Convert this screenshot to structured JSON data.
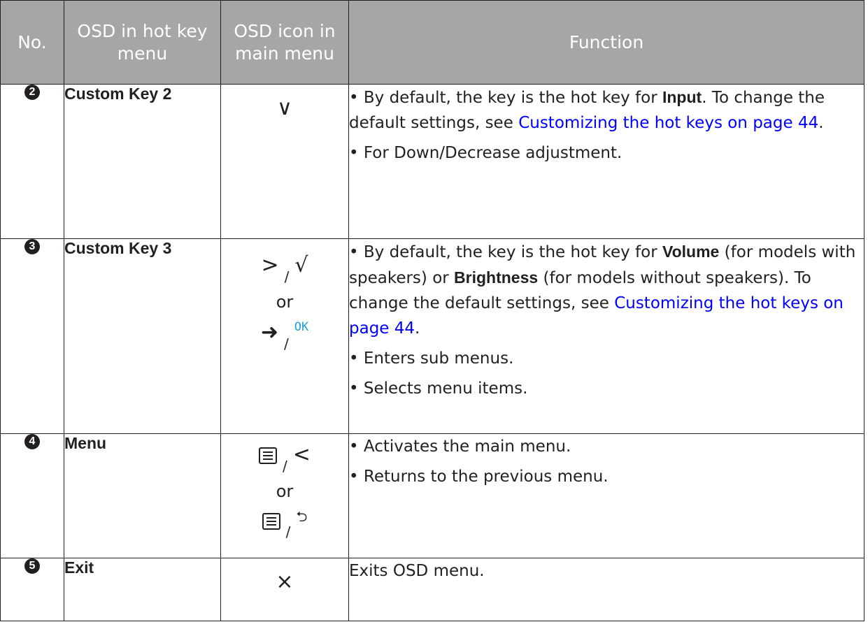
{
  "header": {
    "no": "No.",
    "osd_hot_key": "OSD in hot key menu",
    "osd_icon_main": "OSD icon in main menu",
    "function": "Function"
  },
  "rows": [
    {
      "number": "2",
      "name": "Custom Key 2",
      "icon": {
        "down": "∨"
      },
      "func": {
        "p1_a": "• By default, the key is the hot key for ",
        "p1_b": "Input",
        "p1_c": ". To change the default settings, see ",
        "p1_link": "Customizing the hot keys on page 44",
        "p1_d": ".",
        "p2": "• For Down/Decrease adjustment."
      }
    },
    {
      "number": "3",
      "name": "Custom Key 3",
      "icon": {
        "right": ">",
        "sep": "/",
        "check": "√",
        "or": "or",
        "arrow": "➜",
        "ok": "OK"
      },
      "func": {
        "p1_a": "• By default, the key is the hot key for ",
        "p1_b": "Volume",
        "p1_c": " (for models with speakers) or ",
        "p1_d": "Brightness",
        "p1_e": " (for models without speakers). To change the default settings, see ",
        "p1_link": "Customizing the hot keys on page 44",
        "p1_f": ".",
        "p2": "• Enters sub menus.",
        "p3": "• Selects menu items."
      }
    },
    {
      "number": "4",
      "name": "Menu",
      "icon": {
        "sep": "/",
        "left": "<",
        "or": "or",
        "back": "⮌"
      },
      "func": {
        "p1": "• Activates the main menu.",
        "p2": "• Returns to the previous menu."
      }
    },
    {
      "number": "5",
      "name": "Exit",
      "icon": {
        "close": "×"
      },
      "func": {
        "p1": "Exits OSD menu."
      }
    }
  ]
}
